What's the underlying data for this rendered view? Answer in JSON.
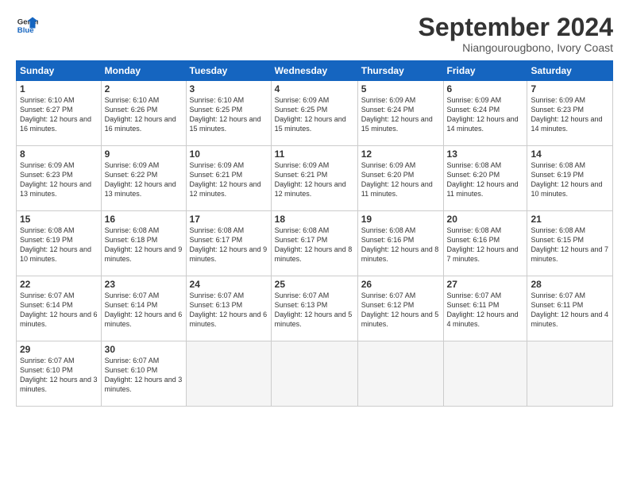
{
  "logo": {
    "line1": "General",
    "line2": "Blue"
  },
  "title": "September 2024",
  "location": "Niangourougbono, Ivory Coast",
  "days_header": [
    "Sunday",
    "Monday",
    "Tuesday",
    "Wednesday",
    "Thursday",
    "Friday",
    "Saturday"
  ],
  "weeks": [
    [
      {
        "num": "1",
        "sunrise": "6:10 AM",
        "sunset": "6:27 PM",
        "daylight": "12 hours and 16 minutes."
      },
      {
        "num": "2",
        "sunrise": "6:10 AM",
        "sunset": "6:26 PM",
        "daylight": "12 hours and 16 minutes."
      },
      {
        "num": "3",
        "sunrise": "6:10 AM",
        "sunset": "6:25 PM",
        "daylight": "12 hours and 15 minutes."
      },
      {
        "num": "4",
        "sunrise": "6:09 AM",
        "sunset": "6:25 PM",
        "daylight": "12 hours and 15 minutes."
      },
      {
        "num": "5",
        "sunrise": "6:09 AM",
        "sunset": "6:24 PM",
        "daylight": "12 hours and 15 minutes."
      },
      {
        "num": "6",
        "sunrise": "6:09 AM",
        "sunset": "6:24 PM",
        "daylight": "12 hours and 14 minutes."
      },
      {
        "num": "7",
        "sunrise": "6:09 AM",
        "sunset": "6:23 PM",
        "daylight": "12 hours and 14 minutes."
      }
    ],
    [
      {
        "num": "8",
        "sunrise": "6:09 AM",
        "sunset": "6:23 PM",
        "daylight": "12 hours and 13 minutes."
      },
      {
        "num": "9",
        "sunrise": "6:09 AM",
        "sunset": "6:22 PM",
        "daylight": "12 hours and 13 minutes."
      },
      {
        "num": "10",
        "sunrise": "6:09 AM",
        "sunset": "6:21 PM",
        "daylight": "12 hours and 12 minutes."
      },
      {
        "num": "11",
        "sunrise": "6:09 AM",
        "sunset": "6:21 PM",
        "daylight": "12 hours and 12 minutes."
      },
      {
        "num": "12",
        "sunrise": "6:09 AM",
        "sunset": "6:20 PM",
        "daylight": "12 hours and 11 minutes."
      },
      {
        "num": "13",
        "sunrise": "6:08 AM",
        "sunset": "6:20 PM",
        "daylight": "12 hours and 11 minutes."
      },
      {
        "num": "14",
        "sunrise": "6:08 AM",
        "sunset": "6:19 PM",
        "daylight": "12 hours and 10 minutes."
      }
    ],
    [
      {
        "num": "15",
        "sunrise": "6:08 AM",
        "sunset": "6:19 PM",
        "daylight": "12 hours and 10 minutes."
      },
      {
        "num": "16",
        "sunrise": "6:08 AM",
        "sunset": "6:18 PM",
        "daylight": "12 hours and 9 minutes."
      },
      {
        "num": "17",
        "sunrise": "6:08 AM",
        "sunset": "6:17 PM",
        "daylight": "12 hours and 9 minutes."
      },
      {
        "num": "18",
        "sunrise": "6:08 AM",
        "sunset": "6:17 PM",
        "daylight": "12 hours and 8 minutes."
      },
      {
        "num": "19",
        "sunrise": "6:08 AM",
        "sunset": "6:16 PM",
        "daylight": "12 hours and 8 minutes."
      },
      {
        "num": "20",
        "sunrise": "6:08 AM",
        "sunset": "6:16 PM",
        "daylight": "12 hours and 7 minutes."
      },
      {
        "num": "21",
        "sunrise": "6:08 AM",
        "sunset": "6:15 PM",
        "daylight": "12 hours and 7 minutes."
      }
    ],
    [
      {
        "num": "22",
        "sunrise": "6:07 AM",
        "sunset": "6:14 PM",
        "daylight": "12 hours and 6 minutes."
      },
      {
        "num": "23",
        "sunrise": "6:07 AM",
        "sunset": "6:14 PM",
        "daylight": "12 hours and 6 minutes."
      },
      {
        "num": "24",
        "sunrise": "6:07 AM",
        "sunset": "6:13 PM",
        "daylight": "12 hours and 6 minutes."
      },
      {
        "num": "25",
        "sunrise": "6:07 AM",
        "sunset": "6:13 PM",
        "daylight": "12 hours and 5 minutes."
      },
      {
        "num": "26",
        "sunrise": "6:07 AM",
        "sunset": "6:12 PM",
        "daylight": "12 hours and 5 minutes."
      },
      {
        "num": "27",
        "sunrise": "6:07 AM",
        "sunset": "6:11 PM",
        "daylight": "12 hours and 4 minutes."
      },
      {
        "num": "28",
        "sunrise": "6:07 AM",
        "sunset": "6:11 PM",
        "daylight": "12 hours and 4 minutes."
      }
    ],
    [
      {
        "num": "29",
        "sunrise": "6:07 AM",
        "sunset": "6:10 PM",
        "daylight": "12 hours and 3 minutes."
      },
      {
        "num": "30",
        "sunrise": "6:07 AM",
        "sunset": "6:10 PM",
        "daylight": "12 hours and 3 minutes."
      },
      null,
      null,
      null,
      null,
      null
    ]
  ]
}
